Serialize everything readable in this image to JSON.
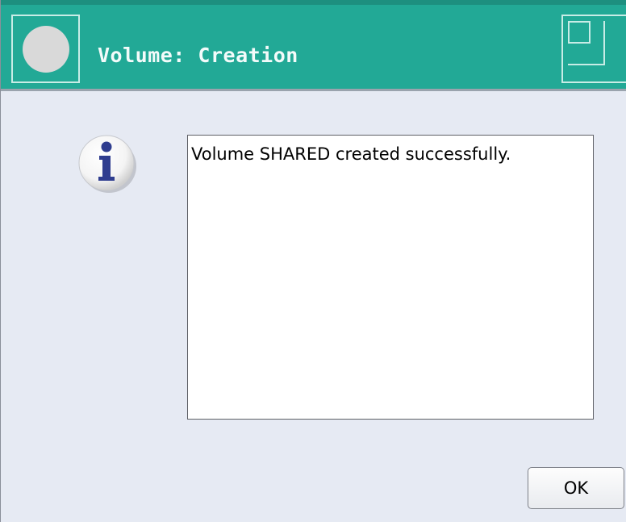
{
  "window": {
    "title": "Volume: Creation",
    "titlebar_color": "#22a996",
    "background_color": "#e6eaf3"
  },
  "titlebar": {
    "menu_icon": "window-menu-icon",
    "maximize_icon": "maximize-icon"
  },
  "dialog": {
    "icon": "info-icon",
    "message": "Volume SHARED created successfully.",
    "ok_label": "OK"
  }
}
